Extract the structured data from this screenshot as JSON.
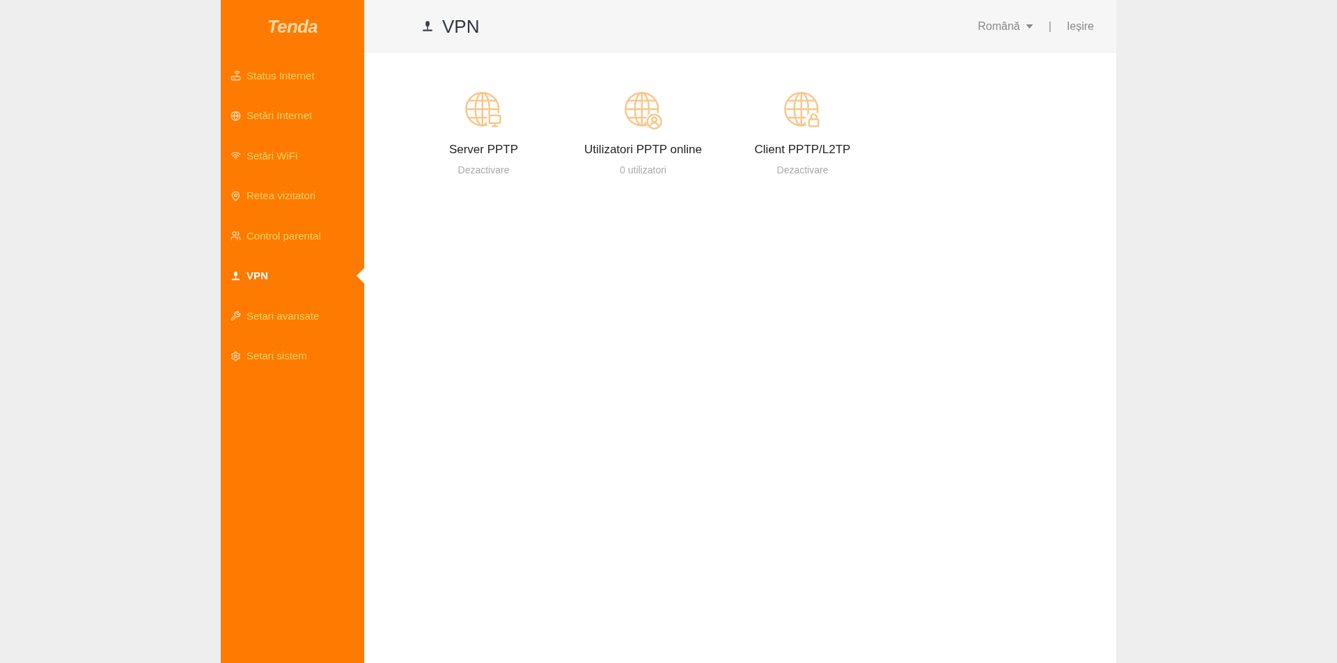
{
  "logo": "Tenda",
  "sidebar": {
    "items": [
      {
        "label": "Status Internet",
        "kind": "router",
        "selected": false
      },
      {
        "label": "Setări Internet",
        "kind": "globe",
        "selected": false
      },
      {
        "label": "Setări WiFi",
        "kind": "wifi",
        "selected": false
      },
      {
        "label": "Retea vizitatori",
        "kind": "guest",
        "selected": false
      },
      {
        "label": "Control parental",
        "kind": "parental",
        "selected": false
      },
      {
        "label": "VPN",
        "kind": "vpn",
        "selected": true
      },
      {
        "label": "Setari avansate",
        "kind": "wrench",
        "selected": false
      },
      {
        "label": "Setari sistem",
        "kind": "gear",
        "selected": false
      }
    ]
  },
  "header": {
    "title": "VPN",
    "language": "Română",
    "separator": "|",
    "logout": "Ieșire"
  },
  "cards": [
    {
      "title": "Server PPTP",
      "status": "Dezactivare",
      "kind": "server"
    },
    {
      "title": "Utilizatori PPTP online",
      "status": "0 utilizatori",
      "kind": "users"
    },
    {
      "title": "Client PPTP/L2TP",
      "status": "Dezactivare",
      "kind": "client"
    }
  ]
}
